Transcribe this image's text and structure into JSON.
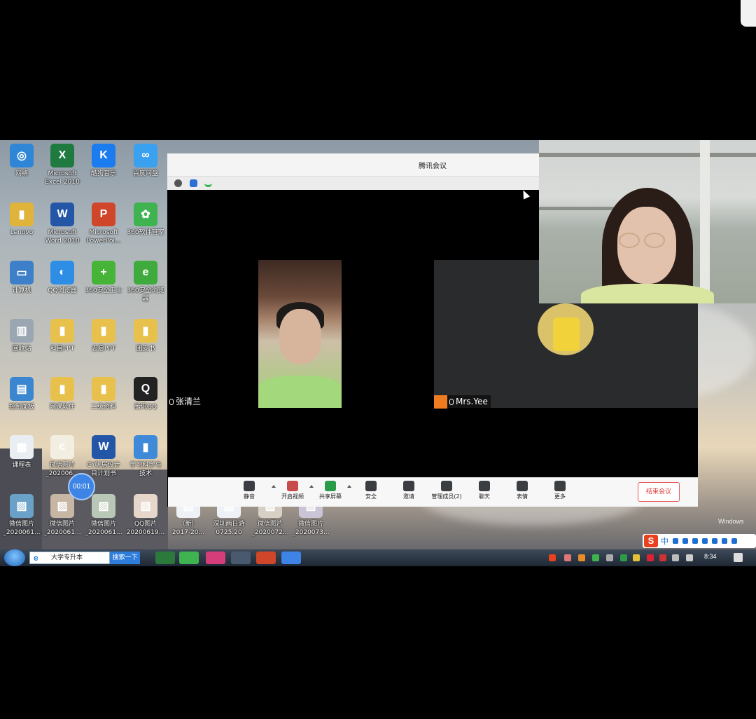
{
  "meeting": {
    "title": "腾讯会议",
    "participants": [
      {
        "name": "张清兰"
      },
      {
        "name": "Mrs.Yee"
      }
    ],
    "toolbar": [
      {
        "label": "静音",
        "icon": "microphone-icon"
      },
      {
        "label": "开启视频",
        "icon": "video-off-icon"
      },
      {
        "label": "共享屏幕",
        "icon": "share-screen-icon"
      },
      {
        "label": "安全",
        "icon": "shield-icon"
      },
      {
        "label": "邀请",
        "icon": "invite-user-icon"
      },
      {
        "label": "管理成员(2)",
        "icon": "members-icon"
      },
      {
        "label": "聊天",
        "icon": "chat-icon"
      },
      {
        "label": "表情",
        "icon": "emoji-icon"
      },
      {
        "label": "更多",
        "icon": "more-icon"
      }
    ],
    "end_label": "结束会议",
    "timer": "00:01"
  },
  "desktop_icons": [
    {
      "label": "网络",
      "color": "#2f86d6",
      "glyph": "◎"
    },
    {
      "label": "Microsoft\nExcel 2010",
      "color": "#1f7a3f",
      "glyph": "X"
    },
    {
      "label": "酷狗音乐",
      "color": "#1b7cf0",
      "glyph": "K"
    },
    {
      "label": "百度网盘",
      "color": "#3aa0f0",
      "glyph": "∞"
    },
    {
      "label": "Lenovo",
      "color": "#e0b43a",
      "glyph": "▮"
    },
    {
      "label": "Microsoft\nWord 2010",
      "color": "#2456a8",
      "glyph": "W"
    },
    {
      "label": "Microsoft\nPowerPoi...",
      "color": "#d0462a",
      "glyph": "P"
    },
    {
      "label": "360软件管家",
      "color": "#3fb34f",
      "glyph": "✿"
    },
    {
      "label": "计算机",
      "color": "#3d7fc8",
      "glyph": "▭"
    },
    {
      "label": "QQ浏览器",
      "color": "#2e8ee6",
      "glyph": "◐"
    },
    {
      "label": "360安全卫士",
      "color": "#45b437",
      "glyph": "+"
    },
    {
      "label": "360安全浏览\n器",
      "color": "#3eab3c",
      "glyph": "e"
    },
    {
      "label": "回收站",
      "color": "#9aa7b2",
      "glyph": "▥"
    },
    {
      "label": "科目PPT",
      "color": "#e8c04c",
      "glyph": "▮"
    },
    {
      "label": "志愿PPT",
      "color": "#e8c04c",
      "glyph": "▮"
    },
    {
      "label": "团支书",
      "color": "#e8c04c",
      "glyph": "▮"
    },
    {
      "label": "控制面板",
      "color": "#3a86d0",
      "glyph": "▤"
    },
    {
      "label": "网课软件",
      "color": "#e8c04c",
      "glyph": "▮"
    },
    {
      "label": "二级资料",
      "color": "#e8c04c",
      "glyph": "▮"
    },
    {
      "label": "腾讯QQ",
      "color": "#222222",
      "glyph": "Q"
    },
    {
      "label": "课程表",
      "color": "#e9eef2",
      "glyph": "▦"
    },
    {
      "label": "微信图片\n_202006...",
      "color": "#f2efe2",
      "glyph": "c"
    },
    {
      "label": "CY帆居设计\n目计划书",
      "color": "#2456a8",
      "glyph": "W"
    },
    {
      "label": "学习科学与\n技术",
      "color": "#3f8ad8",
      "glyph": "▮"
    },
    {
      "label": "微信图片\n_2020061...",
      "color": "#6aa1c8",
      "glyph": "▨"
    },
    {
      "label": "微信图片\n_2020061...",
      "color": "#c7b6a4",
      "glyph": "▨"
    },
    {
      "label": "微信图片\n_2020061...",
      "color": "#b9c7b6",
      "glyph": "▨"
    },
    {
      "label": "QQ图片\n20200619...",
      "color": "#e7d7cb",
      "glyph": "▨"
    },
    {
      "label": "（新）\n2017-20...",
      "color": "#eef2f6",
      "glyph": "▤"
    },
    {
      "label": "深圳两日游\n0725.20",
      "color": "#eef2f6",
      "glyph": "▤"
    },
    {
      "label": "微信图片\n_2020072...",
      "color": "#d7d0c4",
      "glyph": "▨"
    },
    {
      "label": "微信图片\n_2020073...",
      "color": "#c9c4d6",
      "glyph": "▨"
    }
  ],
  "taskbar": {
    "search_text": "大学专升本",
    "search_button": "搜索一下",
    "clock": "8:34"
  },
  "ime": {
    "brand": "S",
    "mode": "中"
  },
  "watermark": "Windows"
}
